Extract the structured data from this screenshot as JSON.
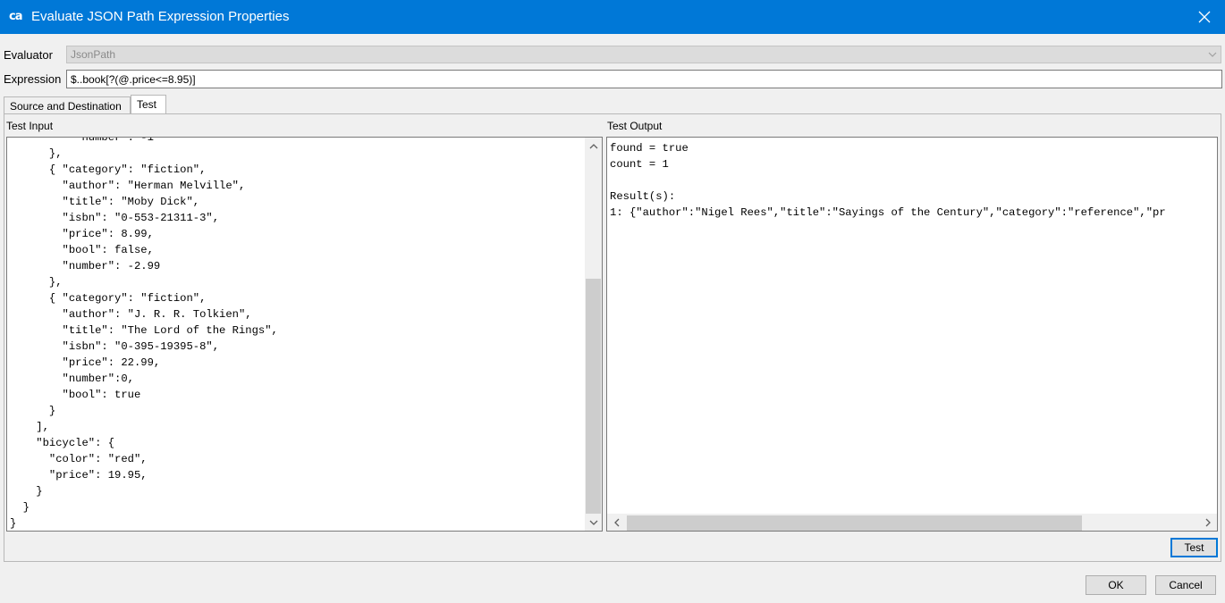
{
  "window": {
    "title": "Evaluate JSON Path Expression Properties",
    "app_icon_text": "ca"
  },
  "evaluator": {
    "label": "Evaluator",
    "value": "JsonPath"
  },
  "expression": {
    "label": "Expression",
    "value": "$..book[?(@.price<=8.95)]"
  },
  "tabs": [
    {
      "label": "Source and Destination",
      "selected": false
    },
    {
      "label": "Test",
      "selected": true
    }
  ],
  "test_input": {
    "header": "Test Input",
    "text": "          \"number\": -1\n      },\n      { \"category\": \"fiction\",\n        \"author\": \"Herman Melville\",\n        \"title\": \"Moby Dick\",\n        \"isbn\": \"0-553-21311-3\",\n        \"price\": 8.99,\n        \"bool\": false,\n        \"number\": -2.99\n      },\n      { \"category\": \"fiction\",\n        \"author\": \"J. R. R. Tolkien\",\n        \"title\": \"The Lord of the Rings\",\n        \"isbn\": \"0-395-19395-8\",\n        \"price\": 22.99,\n        \"number\":0,\n        \"bool\": true\n      }\n    ],\n    \"bicycle\": {\n      \"color\": \"red\",\n      \"price\": 19.95,\n    }\n  }\n}"
  },
  "test_output": {
    "header": "Test Output",
    "text": "found = true\ncount = 1\n\nResult(s):\n1: {\"author\":\"Nigel Rees\",\"title\":\"Sayings of the Century\",\"category\":\"reference\",\"pr"
  },
  "buttons": {
    "test": "Test",
    "ok": "OK",
    "cancel": "Cancel"
  },
  "icons": {
    "close": "close-icon",
    "scroll_up": "chevron-up-icon",
    "scroll_down": "chevron-down-icon",
    "scroll_left": "chevron-left-icon",
    "scroll_right": "chevron-right-icon",
    "dropdown": "chevron-down-icon"
  }
}
